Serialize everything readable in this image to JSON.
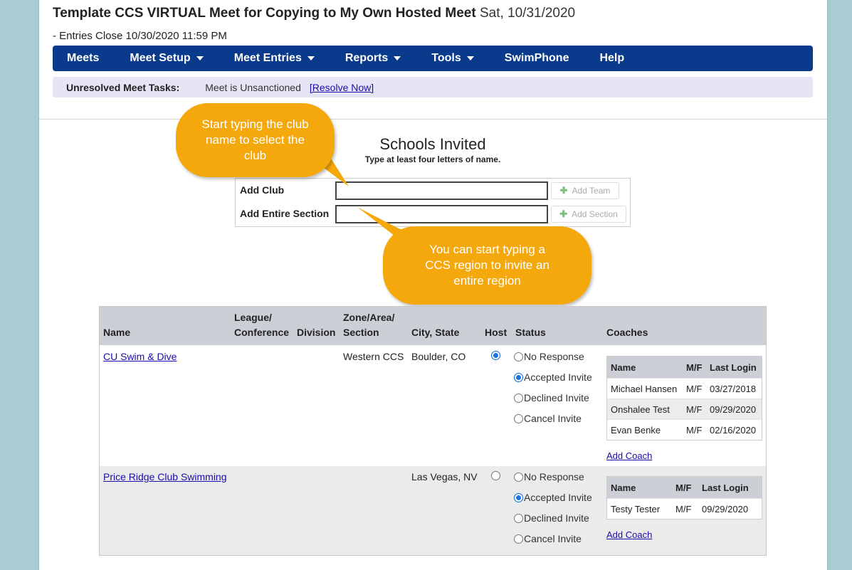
{
  "meet": {
    "title": "Template CCS VIRTUAL Meet for Copying to My Own Hosted Meet",
    "date": "Sat, 10/31/2020",
    "entries_close": "- Entries Close 10/30/2020 11:59 PM"
  },
  "nav": {
    "items": [
      {
        "label": "Meets",
        "dropdown": false
      },
      {
        "label": "Meet Setup",
        "dropdown": true
      },
      {
        "label": "Meet Entries",
        "dropdown": true
      },
      {
        "label": "Reports",
        "dropdown": true
      },
      {
        "label": "Tools",
        "dropdown": true
      },
      {
        "label": "SwimPhone",
        "dropdown": false
      },
      {
        "label": "Help",
        "dropdown": false
      }
    ]
  },
  "tasks": {
    "label": "Unresolved Meet Tasks:",
    "text": "Meet is Unsanctioned",
    "link": "[Resolve Now]"
  },
  "invite": {
    "title": "Schools Invited",
    "subtitle": "Type at least four letters of name.",
    "add_club_label": "Add Club",
    "add_section_label": "Add Entire Section",
    "add_team_button": "Add Team",
    "add_section_button": "Add Section",
    "add_club_value": "",
    "add_section_value": ""
  },
  "callouts": {
    "club": "Start typing the club name to select the club",
    "region": "You can start typing a CCS region to invite an entire region"
  },
  "table": {
    "headers": {
      "name": "Name",
      "league": "League/\nConference",
      "division": "Division",
      "zone": "Zone/Area/\nSection",
      "city": "City, State",
      "host": "Host",
      "status": "Status",
      "coaches": "Coaches"
    },
    "status_options": [
      "No Response",
      "Accepted Invite",
      "Declined Invite",
      "Cancel Invite"
    ],
    "coach_headers": {
      "name": "Name",
      "mf": "M/F",
      "last_login": "Last Login"
    },
    "add_coach_label": "Add Coach",
    "teams": [
      {
        "name": "CU Swim & Dive",
        "league": "",
        "division": "",
        "zone": "Western CCS",
        "city": "Boulder, CO",
        "host": true,
        "status": "Accepted Invite",
        "coaches": [
          {
            "name": "Michael Hansen",
            "mf": "M/F",
            "last_login": "03/27/2018"
          },
          {
            "name": "Onshalee Test",
            "mf": "M/F",
            "last_login": "09/29/2020"
          },
          {
            "name": "Evan Benke",
            "mf": "M/F",
            "last_login": "02/16/2020"
          }
        ]
      },
      {
        "name": "Price Ridge Club Swimming",
        "league": "",
        "division": "",
        "zone": "",
        "city": "Las Vegas, NV",
        "host": false,
        "status": "Accepted Invite",
        "coaches": [
          {
            "name": "Testy Tester",
            "mf": "M/F",
            "last_login": "09/29/2020"
          }
        ]
      }
    ]
  },
  "colors": {
    "nav_bg": "#0a3a8c",
    "tasks_bg": "#e5e5f5",
    "callout": "#f5a80b",
    "sidebar": "#a9ccd3",
    "link": "#1a0dab"
  }
}
